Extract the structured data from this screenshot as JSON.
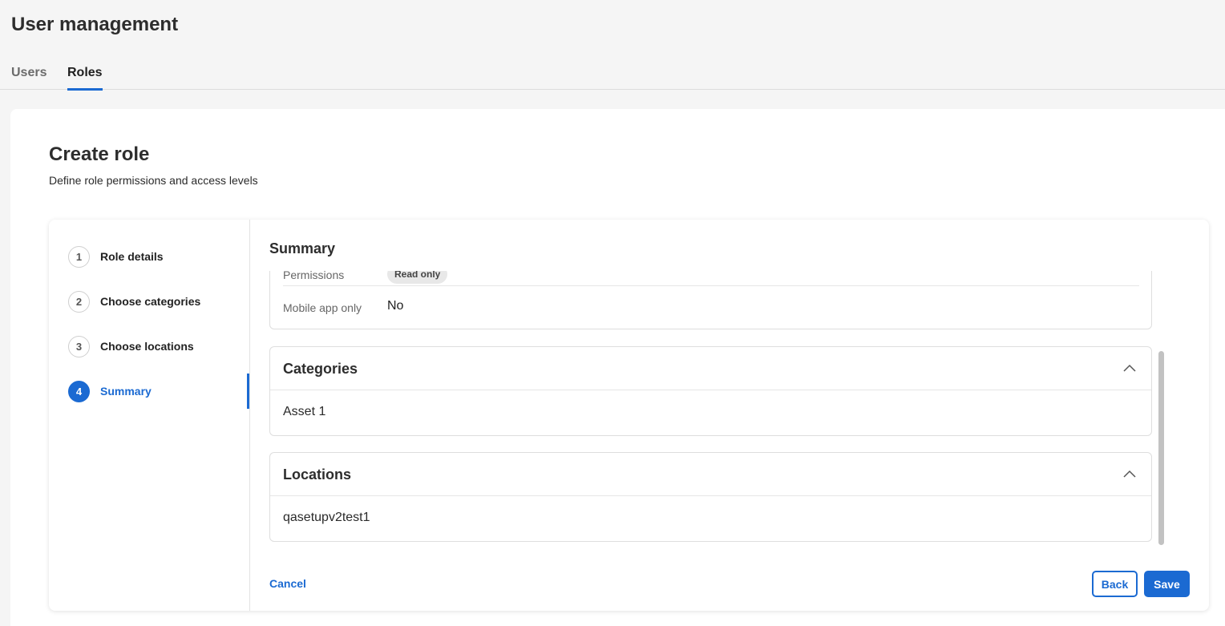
{
  "page": {
    "title": "User management"
  },
  "tabs": [
    {
      "label": "Users"
    },
    {
      "label": "Roles"
    }
  ],
  "card": {
    "title": "Create role",
    "subtitle": "Define role permissions and access levels"
  },
  "steps": [
    {
      "number": "1",
      "label": "Role details"
    },
    {
      "number": "2",
      "label": "Choose categories"
    },
    {
      "number": "3",
      "label": "Choose locations"
    },
    {
      "number": "4",
      "label": "Summary"
    }
  ],
  "summary": {
    "title": "Summary",
    "details": {
      "permissions_label": "Permissions",
      "permissions_value": "Read only",
      "mobile_label": "Mobile app only",
      "mobile_value": "No"
    },
    "categories": {
      "title": "Categories",
      "items": [
        "Asset 1"
      ]
    },
    "locations": {
      "title": "Locations",
      "items": [
        "qasetupv2test1"
      ]
    }
  },
  "footer": {
    "cancel": "Cancel",
    "back": "Back",
    "save": "Save"
  },
  "colors": {
    "accent": "#1b6ad2"
  },
  "icons": {
    "collapse": "chevron-up-icon"
  }
}
